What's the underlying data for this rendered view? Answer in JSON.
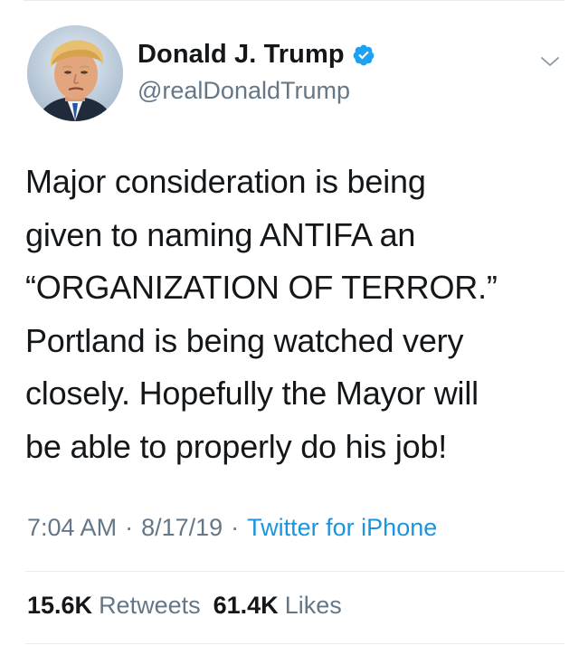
{
  "tweet": {
    "author": {
      "display_name": "Donald J. Trump",
      "handle": "@realDonaldTrump",
      "verified": true,
      "avatar_icon": "profile-photo"
    },
    "text": "Major consideration is being\ngiven to naming ANTIFA an\n“ORGANIZATION OF TERROR.”\nPortland is being watched very\nclosely. Hopefully the Mayor will\nbe able to properly do his job!",
    "time": "7:04 AM",
    "date": "8/17/19",
    "separator": "·",
    "source": "Twitter for iPhone",
    "stats": {
      "retweets_count": "15.6K",
      "retweets_label": "Retweets",
      "likes_count": "61.4K",
      "likes_label": "Likes"
    },
    "menu_icon": "chevron-down-icon"
  },
  "colors": {
    "text_primary": "#14171a",
    "text_secondary": "#657786",
    "link": "#1b95e0",
    "verified_badge": "#1da1f2",
    "divider": "#e6ecf0"
  }
}
